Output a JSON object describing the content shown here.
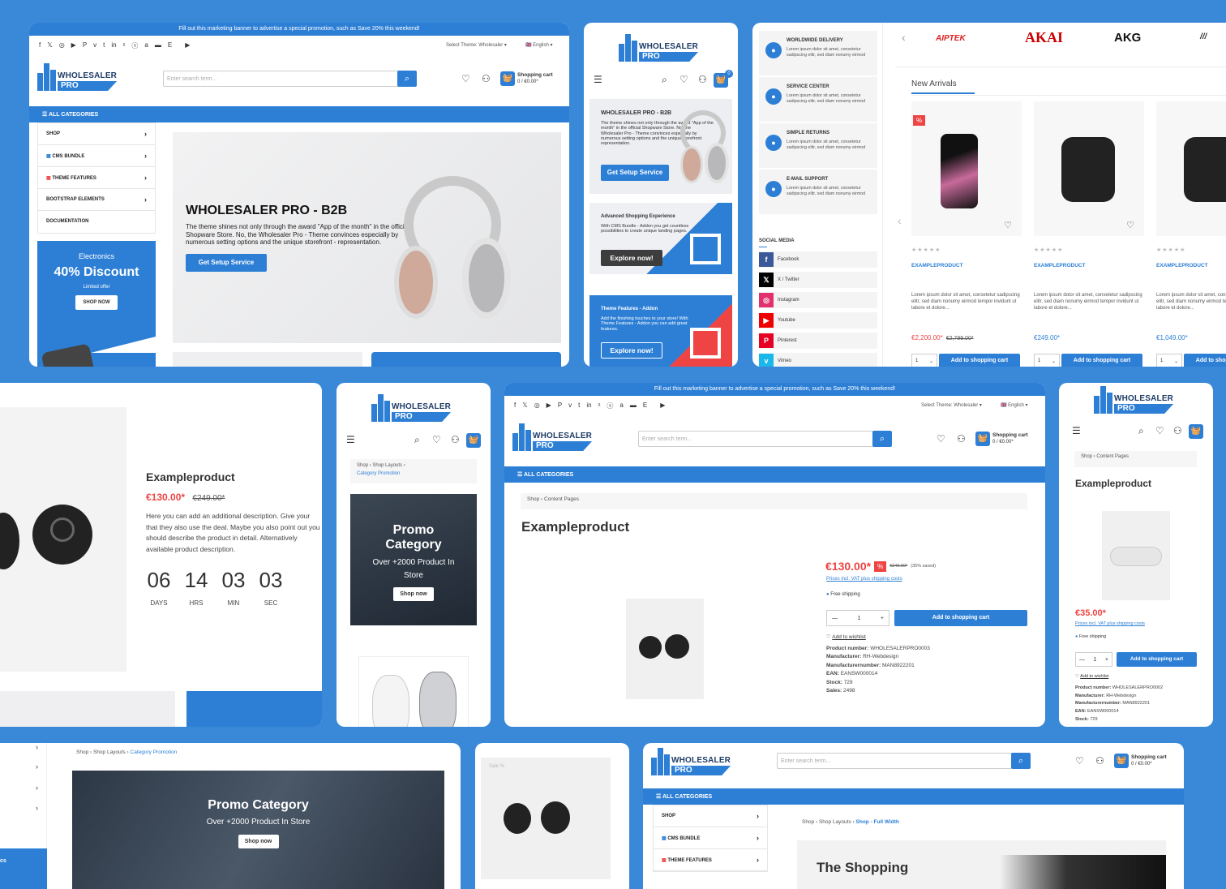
{
  "brand": {
    "line1": "WHOLESALER",
    "line2": "PRO"
  },
  "topbar": {
    "banner": "Fill out this marketing banner to advertise a special promotion, such as Save 20% this weekend!",
    "social_glyphs": [
      "f",
      "𝕏",
      "◎",
      "▶",
      "P",
      "v",
      "t",
      "in",
      "ᵡ",
      "ⓢ",
      "a",
      "▬",
      "Ε",
      "",
      "▶"
    ],
    "theme_select": "Select Theme: Wholesaler ▾",
    "language": "English ▾"
  },
  "header": {
    "search_placeholder": "Enter search term...",
    "cart_label": "Shopping cart",
    "cart_total": "0 / €0.00*",
    "cart_count": "0"
  },
  "nav": {
    "all_categories": "ALL CATEGORIES",
    "items": [
      "SHOP",
      "CMS BUNDLE",
      "THEME FEATURES",
      "BOOTSTRAP ELEMENTS",
      "DOCUMENTATION"
    ]
  },
  "promo_box": {
    "category": "Electronics",
    "headline": "40% Discount",
    "sub": "Limited offer",
    "button": "SHOP NOW"
  },
  "hero": {
    "title": "WHOLESALER PRO - B2B",
    "text": "The theme shines not only through the award \"App of the month\" in the official Shopware Store. No, the Wholesaler Pro - Theme convinces especially by numerous setting options and the unique storefront - representation.",
    "button": "Get Setup Service"
  },
  "mobile_hero": {
    "title": "WHOLESALER PRO - B2B",
    "text": "The theme shines not only through the award \"App of the month\" in the official Shopware Store. No, the Wholesaler Pro - Theme convinces especially by numerous setting options and the unique storefront representation.",
    "button": "Get Setup Service"
  },
  "mobile_cards": [
    {
      "title": "Advanced Shopping Experience",
      "text": "With CMS Bundle - Addon you get countless possibilities to create unique landing pages.",
      "button": "Explore now!"
    },
    {
      "title": "Theme Features - Addon",
      "text": "Add the finishing touches to your store! With Theme Features - Addon you can add great features.",
      "button": "Explore now!"
    }
  ],
  "features": [
    {
      "title": "WORLDWIDE DELIVERY",
      "text": "Lorem ipsum dolor sit amet, consetetur sadipscing elitr, sed diam nonumy eirmod"
    },
    {
      "title": "SERVICE CENTER",
      "text": "Lorem ipsum dolor sit amet, consetetur sadipscing elitr, sed diam nonumy eirmod"
    },
    {
      "title": "SIMPLE RETURNS",
      "text": "Lorem ipsum dolor sit amet, consetetur sadipscing elitr, sed diam nonumy eirmod"
    },
    {
      "title": "E-MAIL SUPPORT",
      "text": "Lorem ipsum dolor sit amet, consetetur sadipscing elitr, sed diam nonumy eirmod"
    }
  ],
  "social_media": {
    "title": "SOCIAL MEDIA",
    "items": [
      "Facebook",
      "X / Twitter",
      "Instagram",
      "Youtube",
      "Pinterest",
      "Vimeo"
    ]
  },
  "brands": [
    "AIPTEK",
    "AKAI",
    "AKG"
  ],
  "new_arrivals": {
    "title": "New Arrivals",
    "products": [
      {
        "name": "EXAMPLEPRODUCT",
        "desc": "Lorem ipsum dolor sit amet, consetetur sadipscing elitr, sed diam nonumy eirmod tempor invidunt ut labore et dolore...",
        "price": "€2,200.00*",
        "old": "€2,799.00*",
        "qty": "1",
        "button": "Add to shopping cart",
        "badge": "%"
      },
      {
        "name": "EXAMPLEPRODUCT",
        "desc": "Lorem ipsum dolor sit amet, consetetur sadipscing elitr, sed diam nonumy eirmod tempor invidunt ut labore et dolore...",
        "price": "€249.00*",
        "old": "",
        "qty": "1",
        "button": "Add to shopping cart",
        "badge": ""
      },
      {
        "name": "EXAMPLEPRODUCT",
        "desc": "Lorem ipsum dolor sit amet, consetetur sadipscing elitr, sed diam nonumy eirmod tempor invidunt ut labore et dolore...",
        "price": "€1,049.00*",
        "old": "",
        "qty": "1",
        "button": "Add to shopping cart",
        "badge": ""
      }
    ]
  },
  "countdown_product": {
    "name": "Exampleproduct",
    "price": "€130.00*",
    "old": "€249.00*",
    "desc": "Here you can add an additional description. Give your that they also use the deal. Maybe you also point out you should describe the product in detail. Alternatively available product description.",
    "timer": [
      {
        "v": "06",
        "l": "DAYS"
      },
      {
        "v": "14",
        "l": "HRS"
      },
      {
        "v": "03",
        "l": "MIN"
      },
      {
        "v": "03",
        "l": "SEC"
      }
    ]
  },
  "mobile_promo": {
    "crumbs": [
      "Shop",
      "Shop Layouts",
      "Category Promotion"
    ],
    "title": "Promo Category",
    "sub": "Over +2000 Product In Store",
    "button": "Shop now"
  },
  "product_detail": {
    "crumbs": [
      "Shop",
      "Content Pages"
    ],
    "name": "Exampleproduct",
    "price": "€130.00*",
    "badge": "%",
    "old": "€249.00*",
    "saved": "(35% saved)",
    "vat": "Prices incl. VAT plus shipping costs",
    "shipping": "Free shipping",
    "qty": "1",
    "button": "Add to shopping cart",
    "wishlist": "Add to wishlist",
    "details": [
      {
        "k": "Product number:",
        "v": "WHOLESALERPRO0003"
      },
      {
        "k": "Manufacturer:",
        "v": "RH-Webdesign"
      },
      {
        "k": "Manufacturernumber:",
        "v": "MAN8922201"
      },
      {
        "k": "EAN:",
        "v": "EANSW000014"
      },
      {
        "k": "Stock:",
        "v": "729"
      },
      {
        "k": "Sales:",
        "v": "2498"
      }
    ]
  },
  "mobile_product": {
    "crumbs": [
      "Shop",
      "Content Pages"
    ],
    "name": "Exampleproduct",
    "price": "€35.00*",
    "vat": "Prices incl. VAT plus shipping costs",
    "shipping": "Free shipping",
    "qty": "1",
    "button": "Add to shopping cart",
    "wishlist": "Add to wishlist",
    "details": [
      {
        "k": "Product number:",
        "v": "WHOLESALERPRO0002"
      },
      {
        "k": "Manufacturer:",
        "v": "RH-Webdesign"
      },
      {
        "k": "Manufacturernumber:",
        "v": "MAN8922201"
      },
      {
        "k": "EAN:",
        "v": "EANSW000014"
      },
      {
        "k": "Stock:",
        "v": "729"
      }
    ]
  },
  "wide_promo": {
    "crumbs": [
      "Shop",
      "Shop Layouts",
      "Category Promotion"
    ],
    "title": "Promo Category",
    "sub": "Over +2000 Product In Store",
    "button": "Shop now",
    "side_label": "cs"
  },
  "small_card": {
    "label": "Sale %"
  },
  "fullwidth": {
    "crumbs": [
      "Shop",
      "Shop Layouts",
      "Shop - Full Width"
    ],
    "heading": "The Shopping"
  }
}
